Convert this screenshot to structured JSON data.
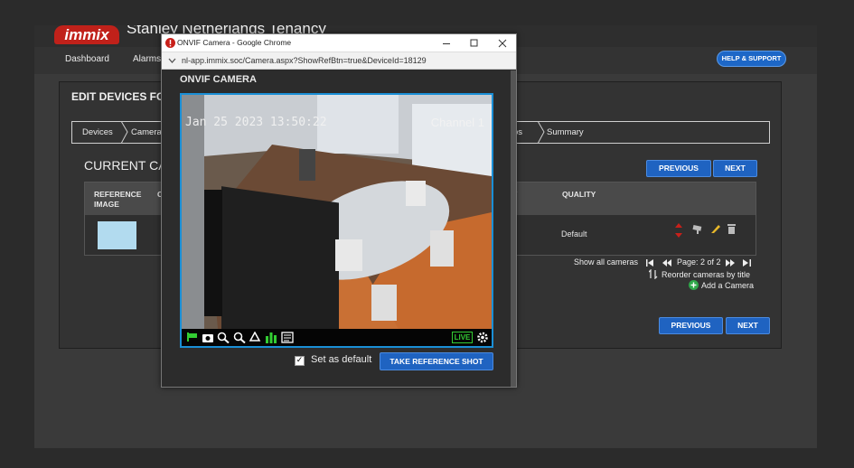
{
  "app": {
    "logo": "immix",
    "tenant": "Stanley Netherlands Tenancy",
    "help_label": "HELP & SUPPORT",
    "nav": [
      "Dashboard",
      "Alarms"
    ]
  },
  "panel": {
    "title": "EDIT DEVICES FOR:",
    "wizard_steps": [
      "Devices",
      "Camera",
      "ps",
      "Summary"
    ],
    "section_title": "CURRENT CAM",
    "previous_label": "PREVIOUS",
    "next_label": "NEXT",
    "table": {
      "headers": [
        "REFERENCE IMAGE",
        "C",
        "T",
        "QUALITY"
      ],
      "row": {
        "quality": "Default"
      }
    },
    "show_all": "Show all cameras",
    "page_text": "Page: 2 of 2",
    "reorder": "Reorder cameras by title",
    "add_camera": "Add a Camera"
  },
  "popup": {
    "window_title": "ONVIF Camera - Google Chrome",
    "url": "nl-app.immix.soc/Camera.aspx?ShowRefBtn=true&DeviceId=18129",
    "heading": "ONVIF CAMERA",
    "timestamp": "Jan 25 2023 13:50:22",
    "channel": "Channel 1",
    "live": "LIVE",
    "set_default": "Set as default",
    "reference_shot": "TAKE REFERENCE SHOT"
  },
  "colors": {
    "accent": "#1f63c1",
    "brand": "#c0211a",
    "viewer_border": "#1a8fd6",
    "live": "#33cc33"
  }
}
